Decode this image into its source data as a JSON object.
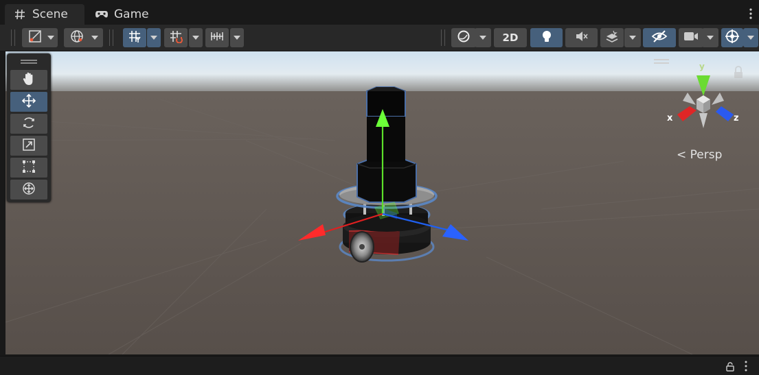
{
  "tabs": [
    {
      "label": "Scene",
      "icon": "hash-icon",
      "active": true
    },
    {
      "label": "Game",
      "icon": "gamepad-icon",
      "active": false
    }
  ],
  "toolbar": {
    "button_2d_label": "2D"
  },
  "tools": [
    "hand-tool",
    "move-tool",
    "rotate-tool",
    "scale-tool",
    "rect-tool",
    "transform-tool"
  ],
  "gizmo": {
    "x_label": "x",
    "y_label": "y",
    "z_label": "z",
    "projection_label": "< Persp"
  },
  "colors": {
    "accent": "#46607c",
    "x_axis": "#e02020",
    "y_axis": "#5ce02a",
    "z_axis": "#2060f0"
  }
}
